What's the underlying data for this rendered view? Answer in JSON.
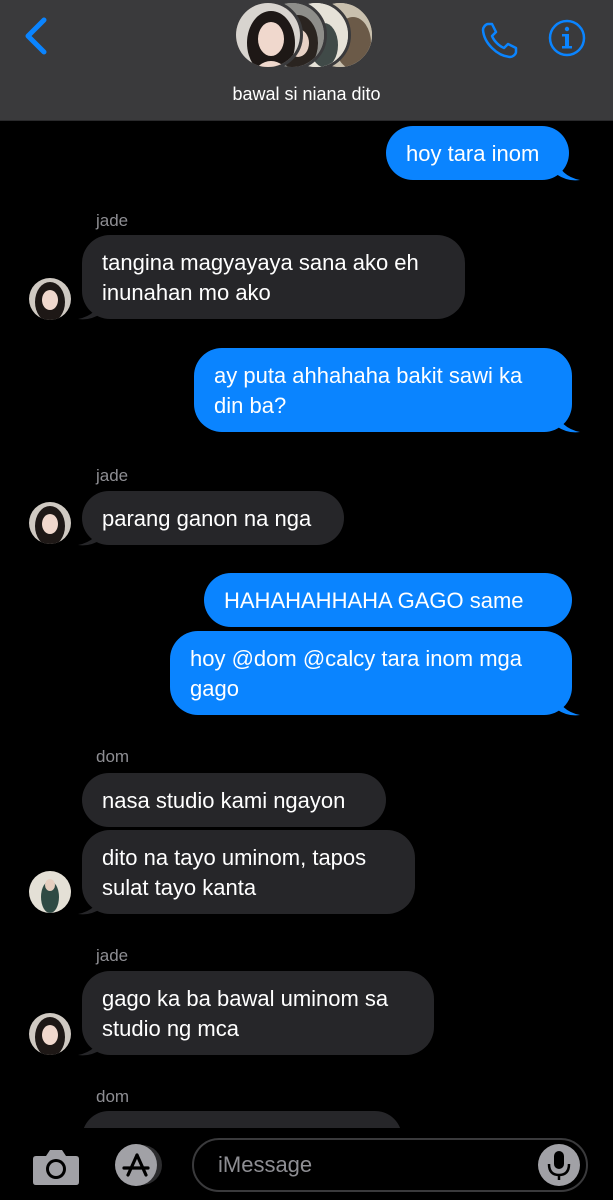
{
  "header": {
    "group_name": "bawal si niana dito",
    "back_icon": "chevron-left-icon",
    "call_icon": "phone-icon",
    "info_icon": "info-icon",
    "accent": "#0a84ff"
  },
  "messages": [
    {
      "side": "out",
      "text": "hoy tara inom"
    },
    {
      "sender": "jade"
    },
    {
      "side": "in",
      "text": "tangina magyayaya sana ako eh\ninunahan mo ako"
    },
    {
      "side": "out",
      "text": "ay puta ahhahaha bakit sawi ka\ndin ba?"
    },
    {
      "sender": "jade"
    },
    {
      "side": "in",
      "text": "parang ganon na nga"
    },
    {
      "side": "out",
      "text": "HAHAHAHHAHA GAGO same"
    },
    {
      "side": "out",
      "text": "hoy @dom @calcy tara inom mga\ngago"
    },
    {
      "sender": "dom"
    },
    {
      "side": "in",
      "text": "nasa studio kami ngayon"
    },
    {
      "side": "in",
      "text": "dito na tayo uminom, tapos\nsulat tayo kanta"
    },
    {
      "sender": "jade"
    },
    {
      "side": "in",
      "text": "gago ka ba bawal uminom sa\nstudio ng mca"
    },
    {
      "sender": "dom"
    }
  ],
  "input": {
    "placeholder": "iMessage"
  },
  "bottom": {
    "camera_icon": "camera-icon",
    "apps_icon": "app-store-icon",
    "mic_icon": "microphone-icon"
  },
  "colors": {
    "outgoing_bubble": "#0a84ff",
    "incoming_bubble": "#262629",
    "header_bg": "#3a3a3c",
    "background": "#000000"
  }
}
